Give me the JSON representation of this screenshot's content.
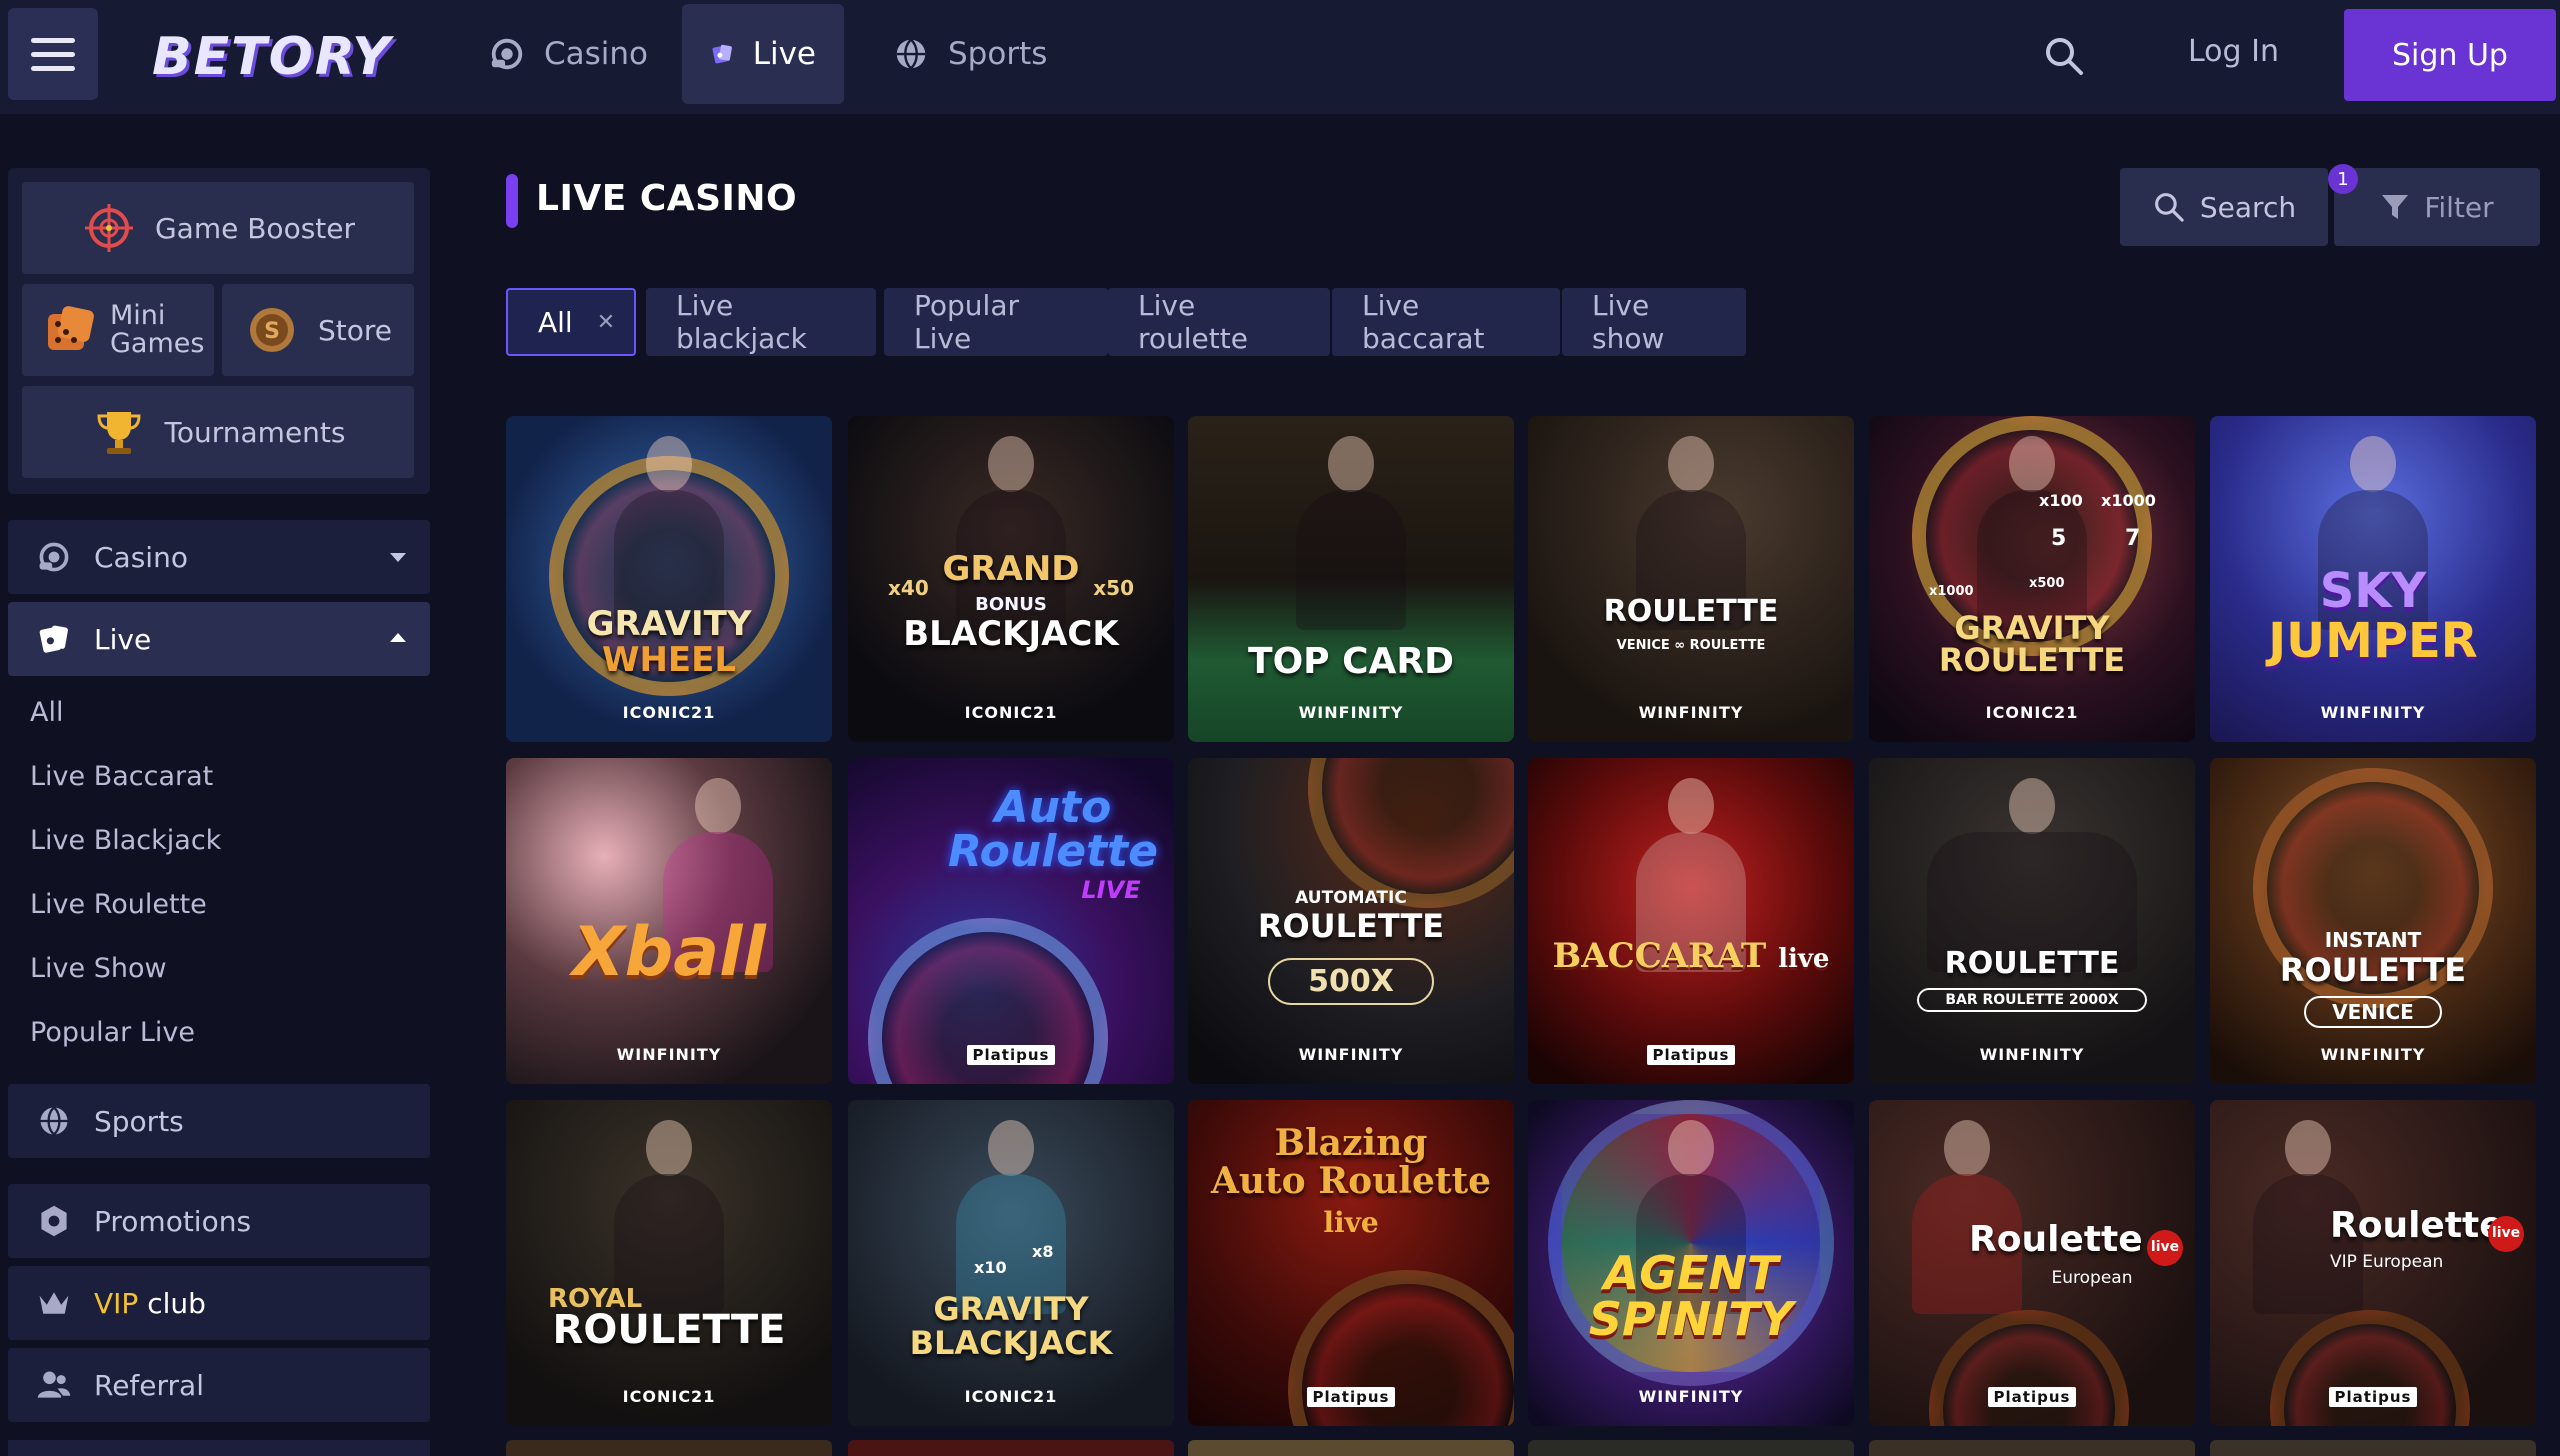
{
  "header": {
    "logo": "BETORY",
    "nav": [
      {
        "label": "Casino",
        "icon": "casino-chip-icon"
      },
      {
        "label": "Live",
        "icon": "live-cards-icon"
      },
      {
        "label": "Sports",
        "icon": "sports-ball-icon"
      }
    ],
    "active_nav": "Live",
    "login_label": "Log In",
    "signup_label": "Sign Up"
  },
  "sidebar": {
    "boxes": {
      "game_booster": "Game Booster",
      "mini_games": "Mini Games",
      "mini_line1": "Mini",
      "mini_line2": "Games",
      "store": "Store",
      "tournaments": "Tournaments"
    },
    "casino_label": "Casino",
    "live_label": "Live",
    "live_subitems": [
      "All",
      "Live Baccarat",
      "Live Blackjack",
      "Live Roulette",
      "Live Show",
      "Popular Live"
    ],
    "sports_label": "Sports",
    "promotions_label": "Promotions",
    "vip_prefix": "VIP",
    "vip_suffix": "club",
    "referral_label": "Referral"
  },
  "main": {
    "title": "LIVE CASINO",
    "search_label": "Search",
    "filter_label": "Filter",
    "filter_count": "1",
    "chips": [
      {
        "label": "All",
        "active": true
      },
      {
        "label": "Live blackjack"
      },
      {
        "label": "Popular Live"
      },
      {
        "label": "Live roulette"
      },
      {
        "label": "Live baccarat"
      },
      {
        "label": "Live show"
      }
    ],
    "games": [
      {
        "title": "GRAVITY WHEEL",
        "line1": "GRAVITY",
        "line2": "WHEEL",
        "brand": "ICONIC21"
      },
      {
        "title": "GRAND BONUS BLACKJACK",
        "line1": "GRAND",
        "line2": "BLACKJACK",
        "extra": "BONUS",
        "m1": "x40",
        "m2": "x50",
        "brand": "ICONIC21"
      },
      {
        "title": "TOP CARD",
        "line1": "TOP CARD",
        "brand": "WINFINITY"
      },
      {
        "title": "ROULETTE VENICE ROULETTE",
        "line1": "ROULETTE",
        "extra": "VENICE ∞ ROULETTE",
        "brand": "WINFINITY"
      },
      {
        "title": "GRAVITY ROULETTE",
        "line1": "GRAVITY",
        "line2": "ROULETTE",
        "m1": "x100",
        "m2": "x1000",
        "m3": "x1000",
        "m4": "x500",
        "n1": "5",
        "n2": "7",
        "brand": "ICONIC21"
      },
      {
        "title": "SKY JUMPER",
        "line1": "SKY",
        "line2": "JUMPER",
        "brand": "WINFINITY"
      },
      {
        "title": "Xball",
        "line1": "Xball",
        "brand": "WINFINITY"
      },
      {
        "title": "Auto Roulette LIVE",
        "line1": "Auto",
        "line2": "Roulette",
        "extra": "LIVE",
        "brand": "Platipus"
      },
      {
        "title": "AUTOMATIC ROULETTE 500X",
        "line0": "AUTOMATIC",
        "line1": "ROULETTE",
        "extra": "500X",
        "brand": "WINFINITY"
      },
      {
        "title": "BACCARAT live",
        "line1": "BACCARAT",
        "extra": "live",
        "brand": "Platipus"
      },
      {
        "title": "ROULETTE BAR ROULETTE 2000X",
        "line1": "ROULETTE",
        "extra": "BAR ROULETTE 2000X",
        "brand": "WINFINITY"
      },
      {
        "title": "INSTANT ROULETTE VENICE",
        "line0": "INSTANT",
        "line1": "ROULETTE",
        "extra": "VENICE",
        "brand": "WINFINITY"
      },
      {
        "title": "ROYAL ROULETTE",
        "line0": "ROYAL",
        "line1": "ROULETTE",
        "brand": "ICONIC21"
      },
      {
        "title": "GRAVITY BLACKJACK",
        "line1": "GRAVITY",
        "line2": "BLACKJACK",
        "m1": "x10",
        "m2": "x8",
        "brand": "ICONIC21"
      },
      {
        "title": "Blazing Auto Roulette live",
        "line1": "Blazing",
        "line2": "Auto Roulette",
        "extra": "live",
        "brand": "Platipus"
      },
      {
        "title": "AGENT SPINITY",
        "line1": "AGENT",
        "line2": "SPINITY",
        "brand": "WINFINITY"
      },
      {
        "title": "Roulette European live",
        "line1": "Roulette",
        "extra": "European",
        "badge": "live",
        "brand": "Platipus"
      },
      {
        "title": "Roulette VIP European live",
        "line1": "Roulette",
        "extra": "VIP European",
        "badge": "live",
        "brand": "Platipus"
      }
    ]
  },
  "colors": {
    "background": "#0f1123",
    "topbar": "#171a33",
    "accent_purple": "#6a34d4",
    "vip_gold": "#f2c230"
  }
}
